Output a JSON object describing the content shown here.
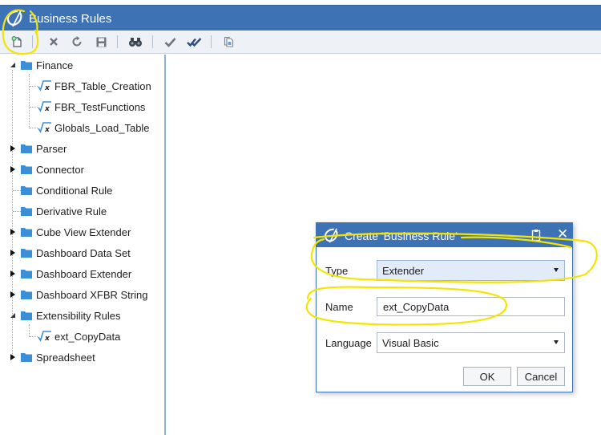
{
  "window": {
    "title": "Business Rules"
  },
  "toolbar": {
    "buttons": [
      {
        "icon": "create-new-icon"
      },
      {
        "icon": "delete-icon"
      },
      {
        "icon": "refresh-icon"
      },
      {
        "icon": "save-icon"
      },
      {
        "icon": "search-binoculars-icon"
      },
      {
        "icon": "check-icon"
      },
      {
        "icon": "check-all-icon"
      },
      {
        "icon": "copy-icon"
      }
    ]
  },
  "tree": {
    "items": [
      {
        "label": "Finance",
        "type": "folder",
        "expanded": true
      },
      {
        "label": "FBR_Table_Creation",
        "type": "rule"
      },
      {
        "label": "FBR_TestFunctions",
        "type": "rule"
      },
      {
        "label": "Globals_Load_Table",
        "type": "rule"
      },
      {
        "label": "Parser",
        "type": "folder",
        "expanded": false
      },
      {
        "label": "Connector",
        "type": "folder",
        "expanded": false
      },
      {
        "label": "Conditional Rule",
        "type": "folder"
      },
      {
        "label": "Derivative Rule",
        "type": "folder"
      },
      {
        "label": "Cube View Extender",
        "type": "folder",
        "expanded": false
      },
      {
        "label": "Dashboard Data Set",
        "type": "folder",
        "expanded": false
      },
      {
        "label": "Dashboard Extender",
        "type": "folder",
        "expanded": false
      },
      {
        "label": "Dashboard XFBR String",
        "type": "folder",
        "expanded": false
      },
      {
        "label": "Extensibility Rules",
        "type": "folder",
        "expanded": true
      },
      {
        "label": "ext_CopyData",
        "type": "rule"
      },
      {
        "label": "Spreadsheet",
        "type": "folder",
        "expanded": false
      }
    ]
  },
  "dialog": {
    "title": "Create 'Business Rule'",
    "type_label": "Type",
    "type_value": "Extender",
    "name_label": "Name",
    "name_value": "ext_CopyData",
    "language_label": "Language",
    "language_value": "Visual Basic",
    "ok_label": "OK",
    "cancel_label": "Cancel"
  },
  "colors": {
    "title_bar": "#3d72b4",
    "folder": "#3b8fd6",
    "annotation": "#f2e600"
  }
}
